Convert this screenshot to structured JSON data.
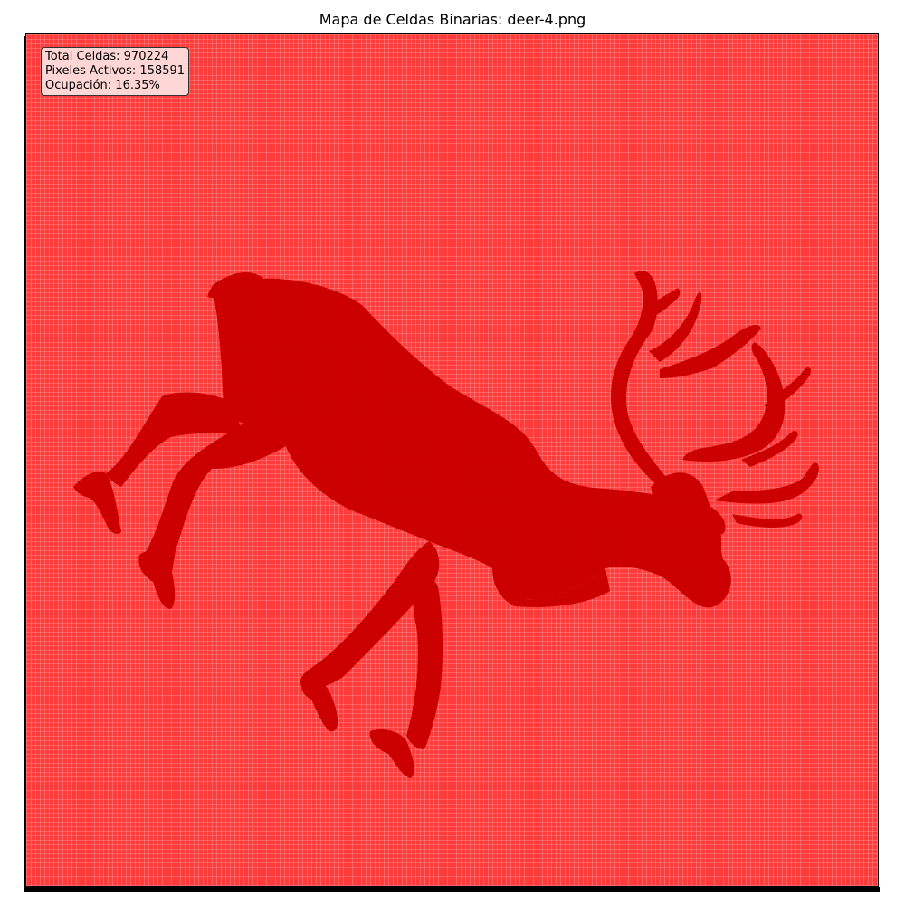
{
  "chart_data": {
    "type": "heatmap",
    "title": "Mapa de Celdas Binarias: deer-4.png",
    "grid": true,
    "legend": "none",
    "colors": {
      "inactive_cell": "#ff3b3b",
      "active_cell": "#cc0000",
      "grid_line": "#ff9c9c",
      "stats_box": "#ffd6d6"
    },
    "subject": "deer silhouette",
    "stats": {
      "total_cells_text": "Total Celdas: 970224",
      "active_pixels_text": "Pixeles Activos: 158591",
      "occupancy_text": "Ocupación: 16.35%",
      "total_cells": 970224,
      "active_pixels": 158591,
      "occupancy_percent": 16.35
    }
  }
}
